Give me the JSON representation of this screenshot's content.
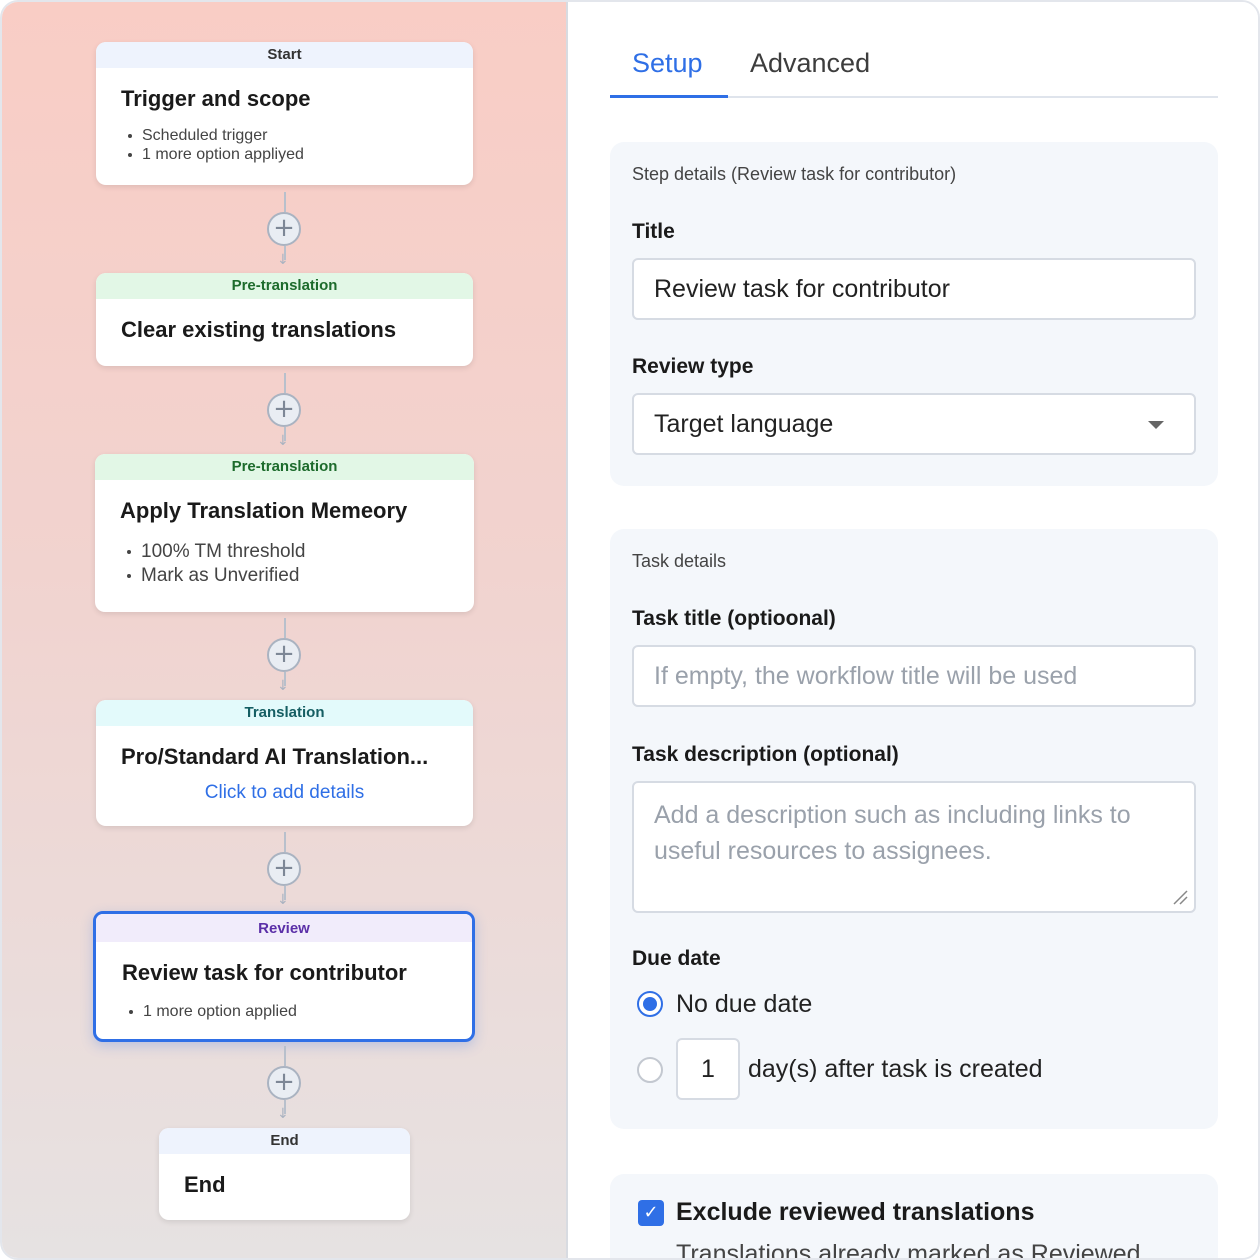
{
  "workflow": {
    "cards": [
      {
        "header": "Start",
        "title": "Trigger and scope",
        "items": [
          "Scheduled trigger",
          "1 more option appliyed"
        ]
      },
      {
        "header": "Pre-translation",
        "title": "Clear existing translations"
      },
      {
        "header": "Pre-translation",
        "title": "Apply Translation Memeory",
        "items": [
          "100% TM threshold",
          "Mark as Unverified"
        ]
      },
      {
        "header": "Translation",
        "title": "Pro/Standard AI Translation...",
        "link": "Click to add details"
      },
      {
        "header": "Review",
        "title": "Review task for contributor",
        "items": [
          "1 more option applied"
        ]
      },
      {
        "header": "End",
        "title": "End"
      }
    ],
    "add_icon": "plus-circle-icon"
  },
  "tabs": {
    "setup": "Setup",
    "advanced": "Advanced"
  },
  "step_details": {
    "section_label": "Step details (Review task for contributor)",
    "title_label": "Title",
    "title_value": "Review task for contributor",
    "review_type_label": "Review type",
    "review_type_value": "Target language"
  },
  "task_details": {
    "section_label": "Task details",
    "task_title_label": "Task title (optioonal)",
    "task_title_placeholder": "If empty, the workflow title will be used",
    "task_desc_label": "Task description (optional)",
    "task_desc_placeholder": "Add a description such as including links to useful resources to assignees.",
    "due_date_label": "Due date",
    "no_due_date": "No due date",
    "days_value": "1",
    "days_after": "day(s) after task is created"
  },
  "exclude": {
    "label": "Exclude reviewed translations",
    "sub": "Translations already marked as Reviewed"
  },
  "colors": {
    "accent": "#2f6fe6",
    "selected_border": "#2f6fe6"
  }
}
